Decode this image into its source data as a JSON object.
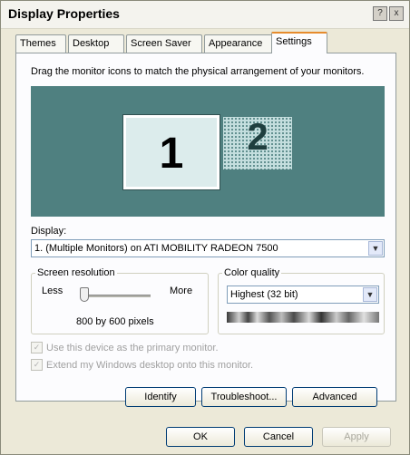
{
  "window": {
    "title": "Display Properties",
    "help_btn": "?",
    "close_btn": "x"
  },
  "tabs": [
    "Themes",
    "Desktop",
    "Screen Saver",
    "Appearance",
    "Settings"
  ],
  "active_tab": "Settings",
  "instruction": "Drag the monitor icons to match the physical arrangement of your monitors.",
  "monitors": {
    "primary": "1",
    "secondary": "2"
  },
  "display": {
    "label": "Display:",
    "value": "1. (Multiple Monitors) on ATI MOBILITY RADEON 7500"
  },
  "resolution": {
    "legend": "Screen resolution",
    "less": "Less",
    "more": "More",
    "value_text": "800 by 600 pixels",
    "slider_level": 0.0
  },
  "color_quality": {
    "legend": "Color quality",
    "value": "Highest (32 bit)"
  },
  "checkboxes": {
    "primary": "Use this device as the primary monitor.",
    "extend": "Extend my Windows desktop onto this monitor."
  },
  "buttons": {
    "identify": "Identify",
    "troubleshoot": "Troubleshoot...",
    "advanced": "Advanced",
    "ok": "OK",
    "cancel": "Cancel",
    "apply": "Apply"
  },
  "icons": {
    "dropdown": "chevron-down-icon",
    "check": "checkmark-icon"
  }
}
